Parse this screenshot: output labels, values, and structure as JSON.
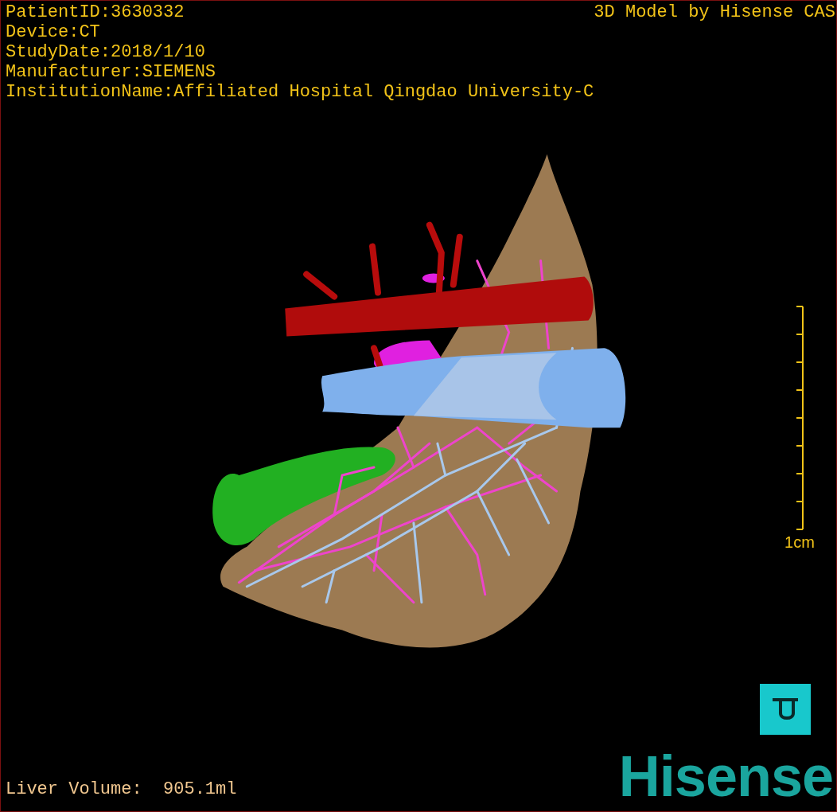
{
  "info_lines": [
    "PatientID:3630332",
    "Device:CT",
    "StudyDate:2018/1/10",
    "Manufacturer:SIEMENS",
    "InstitutionName:Affiliated Hospital Qingdao University-C"
  ],
  "title": "3D Model by Hisense CAS",
  "scale_bar": {
    "label": "1cm"
  },
  "liver_volume": "Liver Volume:  905.1ml",
  "logo": "Hisense"
}
